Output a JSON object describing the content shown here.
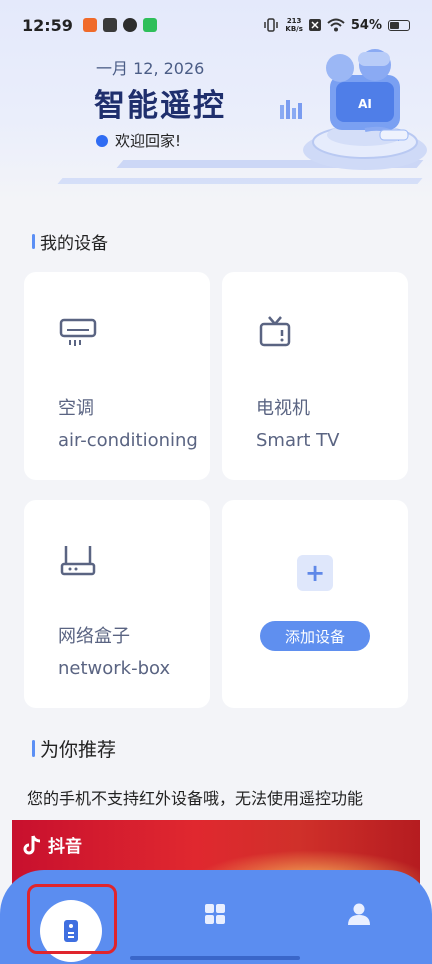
{
  "status_bar": {
    "time": "12:59",
    "speed_value": "213",
    "speed_unit": "KB/s",
    "battery": "54%",
    "battery_level": 0.54
  },
  "banner": {
    "date": "一月 12, 2026",
    "title": "智能遥控",
    "welcome": "欢迎回家!",
    "illustration_label": "AI"
  },
  "sections": {
    "my_devices": "我的设备",
    "recommend": "为你推荐"
  },
  "devices": [
    {
      "name": "空调",
      "subtitle": "air-conditioning",
      "icon": "air-conditioner-icon"
    },
    {
      "name": "电视机",
      "subtitle": "Smart TV",
      "icon": "tv-icon"
    },
    {
      "name": "网络盒子",
      "subtitle": "network-box",
      "icon": "router-icon"
    }
  ],
  "add_device": {
    "label": "添加设备",
    "icon": "plus-icon"
  },
  "notice": "您的手机不支持红外设备哦，无法使用遥控功能",
  "ad": {
    "brand": "抖音"
  },
  "bottom_nav": {
    "items": [
      {
        "icon": "remote-icon",
        "active": true
      },
      {
        "icon": "grid-icon",
        "active": false
      },
      {
        "icon": "person-icon",
        "active": false
      }
    ]
  },
  "colors": {
    "accent": "#5b8df0",
    "highlight": "#e0252c"
  }
}
